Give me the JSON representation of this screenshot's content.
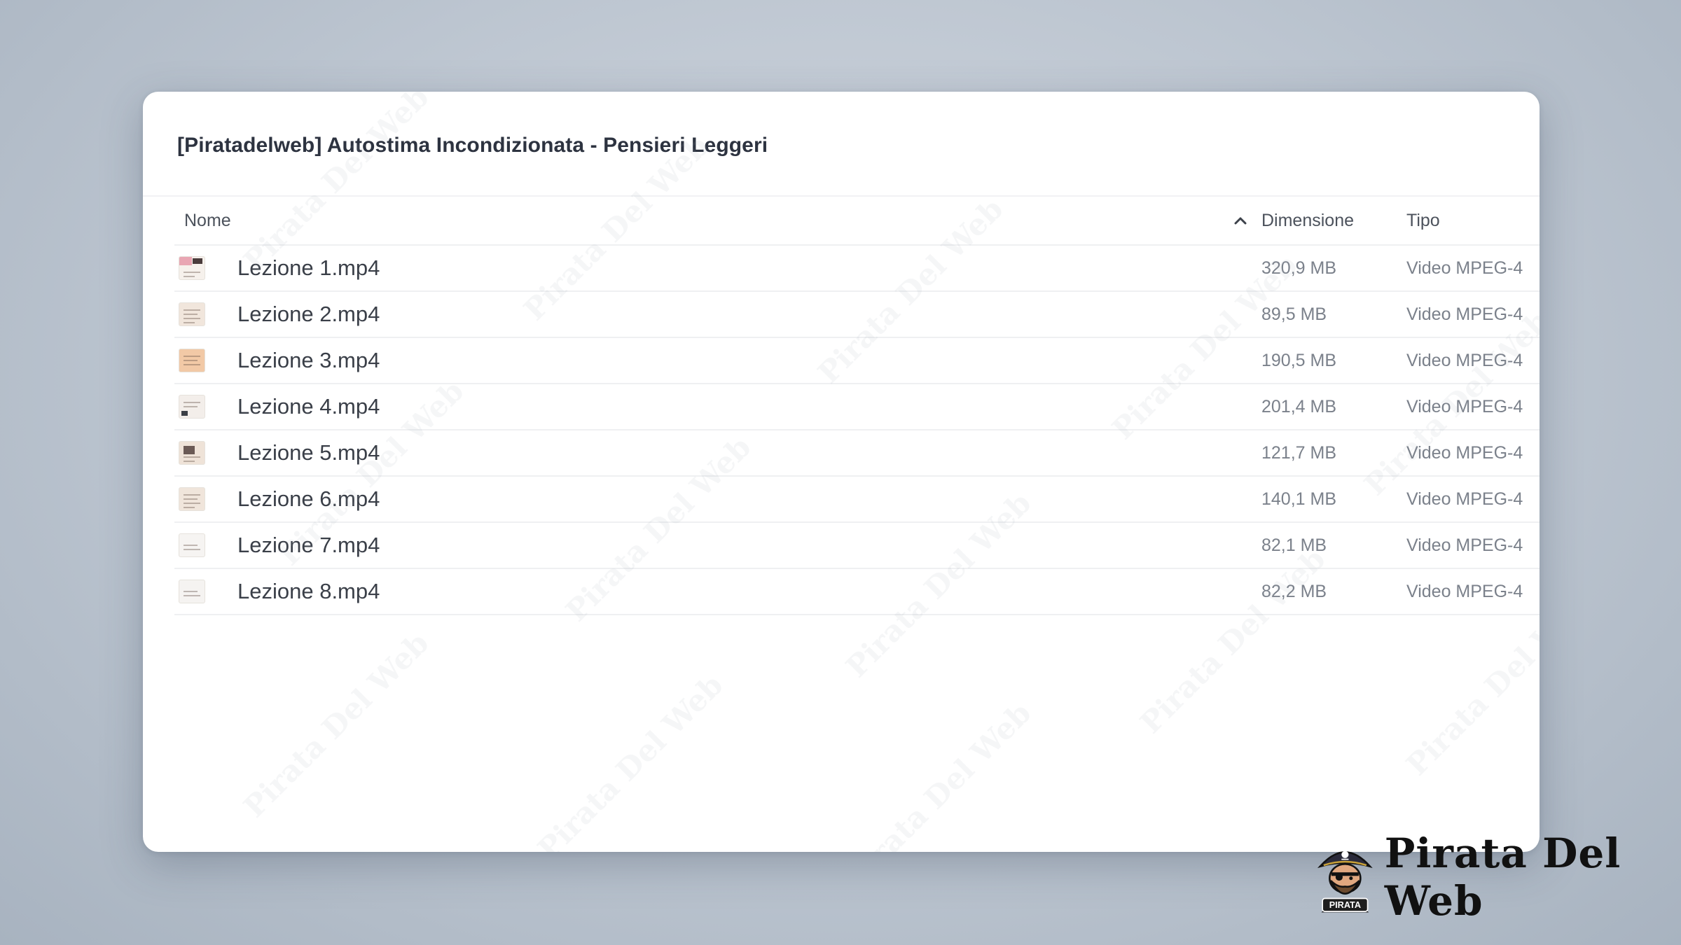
{
  "window": {
    "title": "[Piratadelweb] Autostima Incondizionata - Pensieri Leggeri"
  },
  "table": {
    "columns": {
      "name": "Nome",
      "size": "Dimensione",
      "type": "Tipo"
    },
    "sort": {
      "column": "name",
      "direction": "ascending",
      "icon": "chevron-up-icon"
    },
    "rows": [
      {
        "name": "Lezione 1.mp4",
        "size": "320,9 MB",
        "type": "Video MPEG-4"
      },
      {
        "name": "Lezione 2.mp4",
        "size": "89,5 MB",
        "type": "Video MPEG-4"
      },
      {
        "name": "Lezione 3.mp4",
        "size": "190,5 MB",
        "type": "Video MPEG-4"
      },
      {
        "name": "Lezione 4.mp4",
        "size": "201,4 MB",
        "type": "Video MPEG-4"
      },
      {
        "name": "Lezione 5.mp4",
        "size": "121,7 MB",
        "type": "Video MPEG-4"
      },
      {
        "name": "Lezione 6.mp4",
        "size": "140,1 MB",
        "type": "Video MPEG-4"
      },
      {
        "name": "Lezione 7.mp4",
        "size": "82,1 MB",
        "type": "Video MPEG-4"
      },
      {
        "name": "Lezione 8.mp4",
        "size": "82,2 MB",
        "type": "Video MPEG-4"
      }
    ]
  },
  "watermark": {
    "text": "Pirata Del Web"
  },
  "branding": {
    "name": "Pirata Del Web",
    "logo_label": "PIRATA"
  },
  "colors": {
    "background": "#bcc5d0",
    "window": "#ffffff",
    "text_primary": "#3a3f48",
    "text_secondary": "#7b818b",
    "divider": "#eff0f2"
  }
}
